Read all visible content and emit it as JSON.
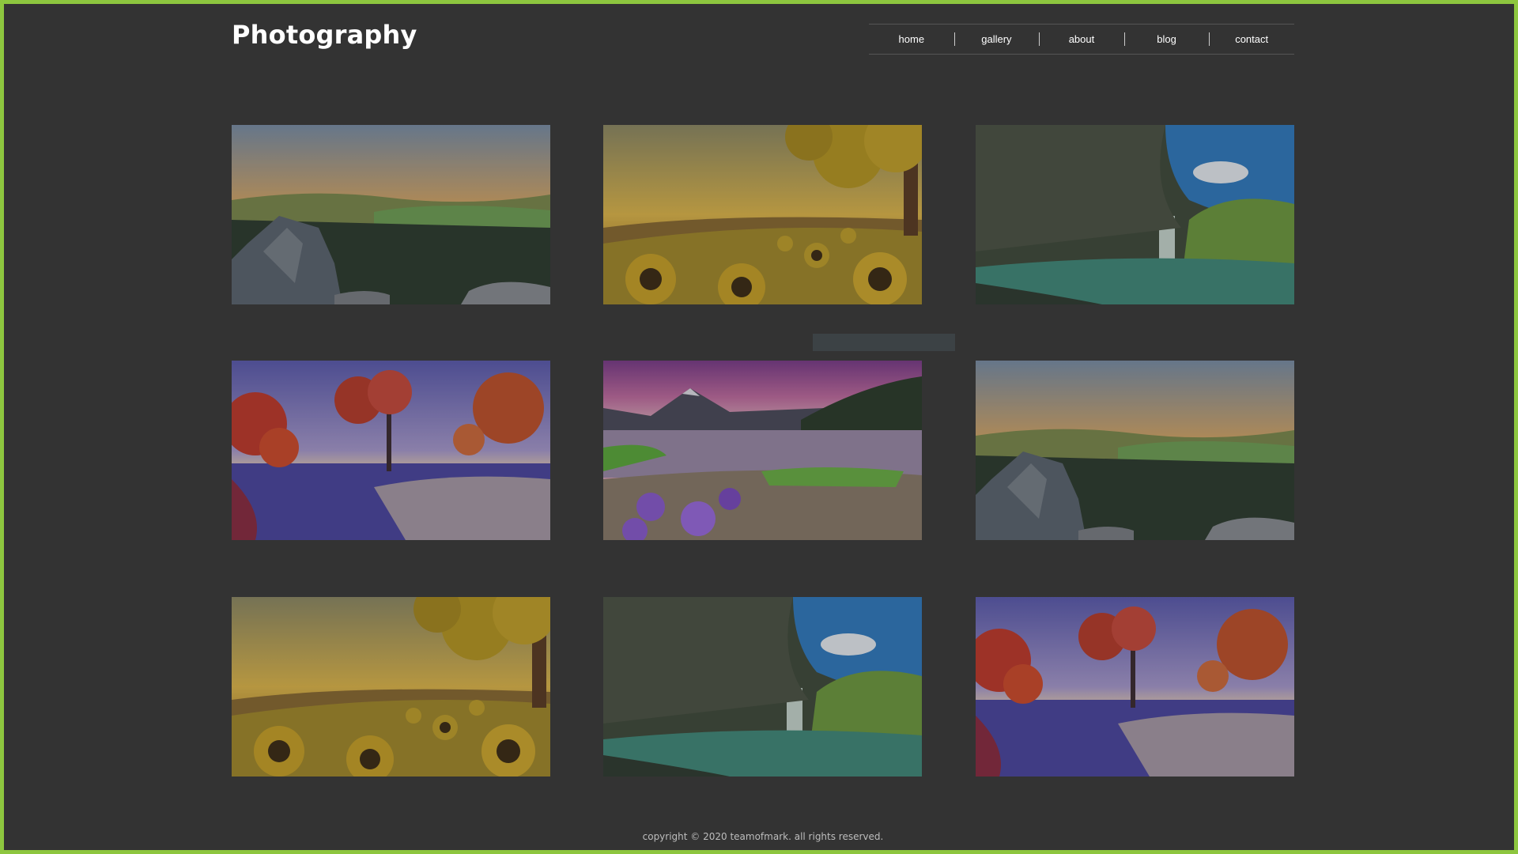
{
  "site": {
    "title": "Photography"
  },
  "nav": {
    "items": [
      {
        "label": "home"
      },
      {
        "label": "gallery"
      },
      {
        "label": "about"
      },
      {
        "label": "blog"
      },
      {
        "label": "contact"
      }
    ]
  },
  "gallery": {
    "photos": [
      {
        "subject": "sunset-rocks-forest"
      },
      {
        "subject": "sunflowers-tree"
      },
      {
        "subject": "cave-waterfall"
      },
      {
        "subject": "autumn-lake-trees"
      },
      {
        "subject": "mountain-lake-flowers"
      },
      {
        "subject": "sunset-rocks-forest"
      },
      {
        "subject": "sunflowers-tree"
      },
      {
        "subject": "cave-waterfall"
      },
      {
        "subject": "autumn-lake-trees"
      }
    ]
  },
  "footer": {
    "text": "copyright © 2020 teamofmark. all rights reserved."
  },
  "colors": {
    "frame": "#8dc63f",
    "background": "#333333",
    "text": "#ffffff"
  }
}
